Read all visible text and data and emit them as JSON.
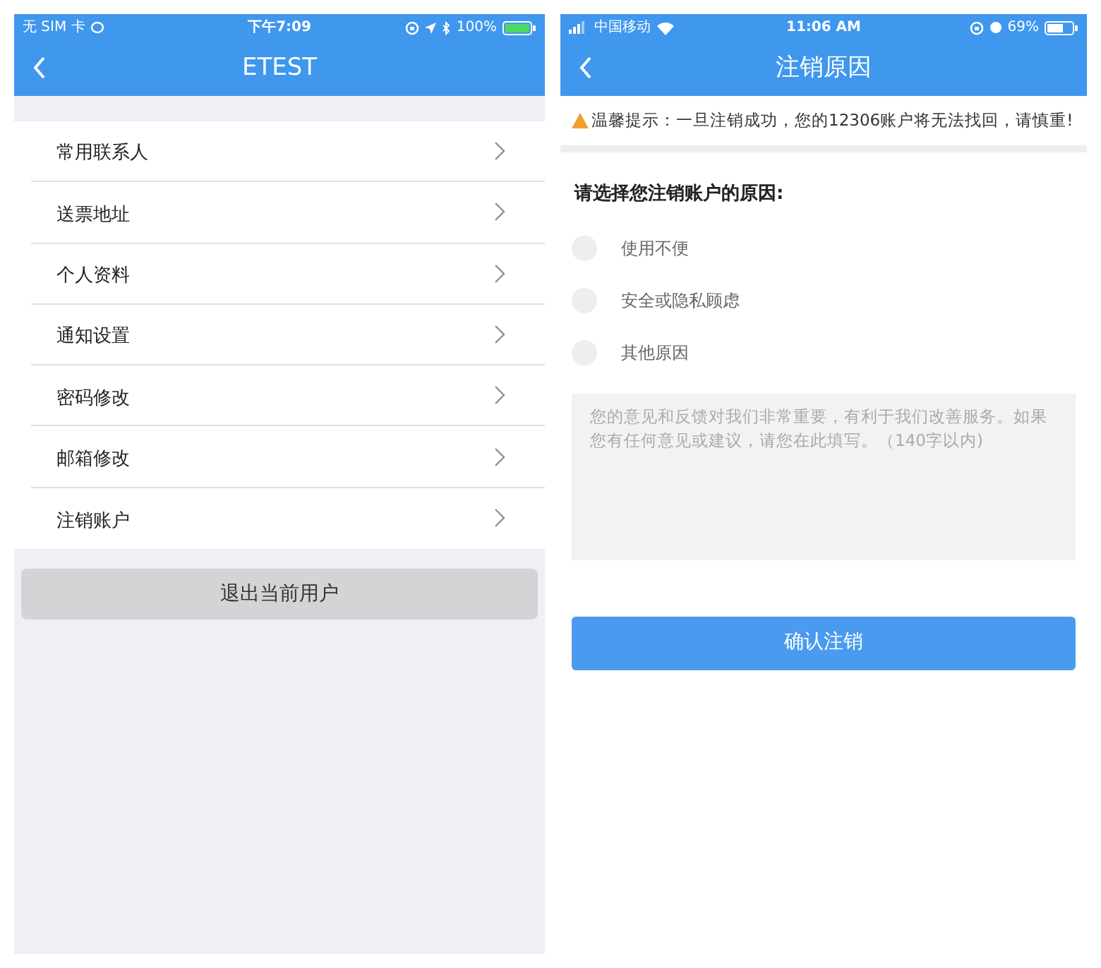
{
  "left_screen": {
    "status_bar": {
      "carrier": "无 SIM 卡",
      "time": "下午7:09",
      "battery": "100%"
    },
    "nav": {
      "title": "ETEST"
    },
    "menu_items": [
      {
        "label": "常用联系人"
      },
      {
        "label": "送票地址"
      },
      {
        "label": "个人资料"
      },
      {
        "label": "通知设置"
      },
      {
        "label": "密码修改"
      },
      {
        "label": "邮箱修改"
      },
      {
        "label": "注销账户"
      }
    ],
    "logout_button": "退出当前用户"
  },
  "right_screen": {
    "status_bar": {
      "carrier": "中国移动",
      "time": "11:06 AM",
      "battery": "69%"
    },
    "nav": {
      "title": "注销原因"
    },
    "notice": "温馨提示：一旦注销成功，您的12306账户将无法找回，请慎重!",
    "question": "请选择您注销账户的原因:",
    "reasons": [
      {
        "label": "使用不便",
        "selected": false
      },
      {
        "label": "安全或隐私顾虑",
        "selected": false
      },
      {
        "label": "其他原因",
        "selected": false
      }
    ],
    "feedback": {
      "placeholder": "您的意见和反馈对我们非常重要，有利于我们改善服务。如果您有任何意见或建议，请您在此填写。（140字以内)"
    },
    "confirm_button": "确认注销"
  }
}
